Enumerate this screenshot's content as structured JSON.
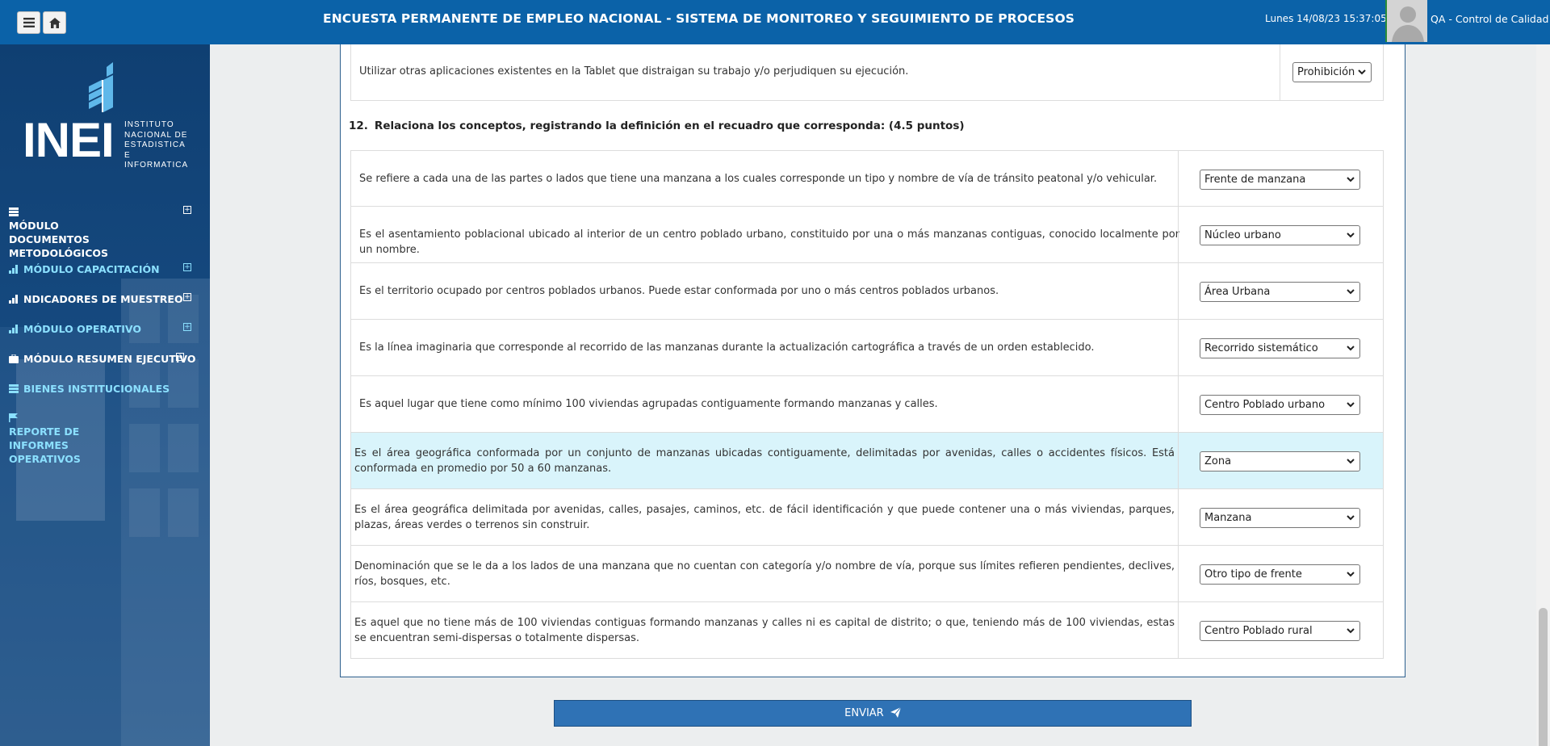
{
  "header": {
    "title": "ENCUESTA PERMANENTE DE EMPLEO NACIONAL - SISTEMA DE MONITOREO Y SEGUIMIENTO DE PROCESOS",
    "datetime": "Lunes 14/08/23 15:37:05",
    "user": "QA - Control de Calidad",
    "menu_icon": "hamburger-icon",
    "home_icon": "home-icon"
  },
  "logo": {
    "big": "INEI",
    "line1": "INSTITUTO",
    "line2": "NACIONAL DE",
    "line3": "ESTADISTICA E",
    "line4": "INFORMATICA"
  },
  "sidebar": {
    "items": [
      {
        "label": "MÓDULO DOCUMENTOS METODOLÓGICOS",
        "icon": "document-icon"
      },
      {
        "label": "MÓDULO CAPACITACIÓN",
        "icon": "bar-chart-icon"
      },
      {
        "label": "NDICADORES DE MUESTREO",
        "icon": "bar-chart-icon"
      },
      {
        "label": "MÓDULO OPERATIVO",
        "icon": "bar-chart-icon"
      },
      {
        "label": "MÓDULO RESUMEN EJECUTIVO",
        "icon": "briefcase-icon"
      },
      {
        "label": "BIENES INSTITUCIONALES",
        "icon": "table-icon"
      },
      {
        "label": "REPORTE DE INFORMES OPERATIVOS",
        "icon": "flag-icon"
      }
    ]
  },
  "prev_row": {
    "text": "Utilizar otras aplicaciones existentes en la Tablet que distraigan su trabajo y/o perjudiquen su ejecución.",
    "value": "Prohibición"
  },
  "question": {
    "number": "12.",
    "text": "Relaciona los conceptos, registrando la definición en el recuadro que corresponda: (4.5 puntos)"
  },
  "rows": [
    {
      "text": "Se refiere a cada una de las partes o lados que tiene una manzana a los cuales corresponde un tipo y nombre de vía de tránsito peatonal y/o vehicular.",
      "value": "Frente de manzana"
    },
    {
      "text": "Es el asentamiento poblacional ubicado al interior de un centro poblado urbano, constituido por una o más manzanas contiguas, conocido localmente por un nombre.",
      "value": "Núcleo urbano"
    },
    {
      "text": "Es el territorio ocupado por centros poblados urbanos. Puede estar conformada por uno o más centros poblados urbanos.",
      "value": "Área Urbana"
    },
    {
      "text": "Es la línea imaginaria que corresponde al recorrido de las manzanas durante la actualización cartográfica a través de un orden establecido.",
      "value": "Recorrido sistemático"
    },
    {
      "text": "Es aquel lugar que tiene como mínimo 100 viviendas agrupadas contiguamente formando manzanas y calles.",
      "value": "Centro Poblado urbano"
    },
    {
      "text": "Es el área geográfica conformada por un conjunto de manzanas ubicadas contiguamente, delimitadas por avenidas, calles o accidentes físicos. Está conformada en promedio por 50 a 60 manzanas.",
      "value": "Zona"
    },
    {
      "text": "Es el área geográfica delimitada por avenidas, calles, pasajes, caminos, etc. de fácil identificación y que puede contener una o más viviendas, parques, plazas, áreas verdes o terrenos sin construir.",
      "value": "Manzana"
    },
    {
      "text": "Denominación que se le da a los lados de una manzana que no cuentan con categoría y/o nombre de vía, porque sus límites refieren pendientes, declives, ríos, bosques, etc.",
      "value": "Otro tipo de frente"
    },
    {
      "text": "Es aquel que no tiene más de 100 viviendas contiguas formando manzanas y calles ni es capital de distrito; o que, teniendo más de 100 viviendas, estas se encuentran semi-dispersas o totalmente dispersas.",
      "value": "Centro Poblado rural"
    }
  ],
  "submit": {
    "label": "ENVIAR",
    "icon": "paper-plane-icon"
  },
  "colors": {
    "header": "#0b62a8",
    "sidebar": "#0f3f72",
    "highlight_row": "#d9f4fb",
    "submit": "#2f72b5",
    "cyan_menu": "#8be0ff"
  }
}
